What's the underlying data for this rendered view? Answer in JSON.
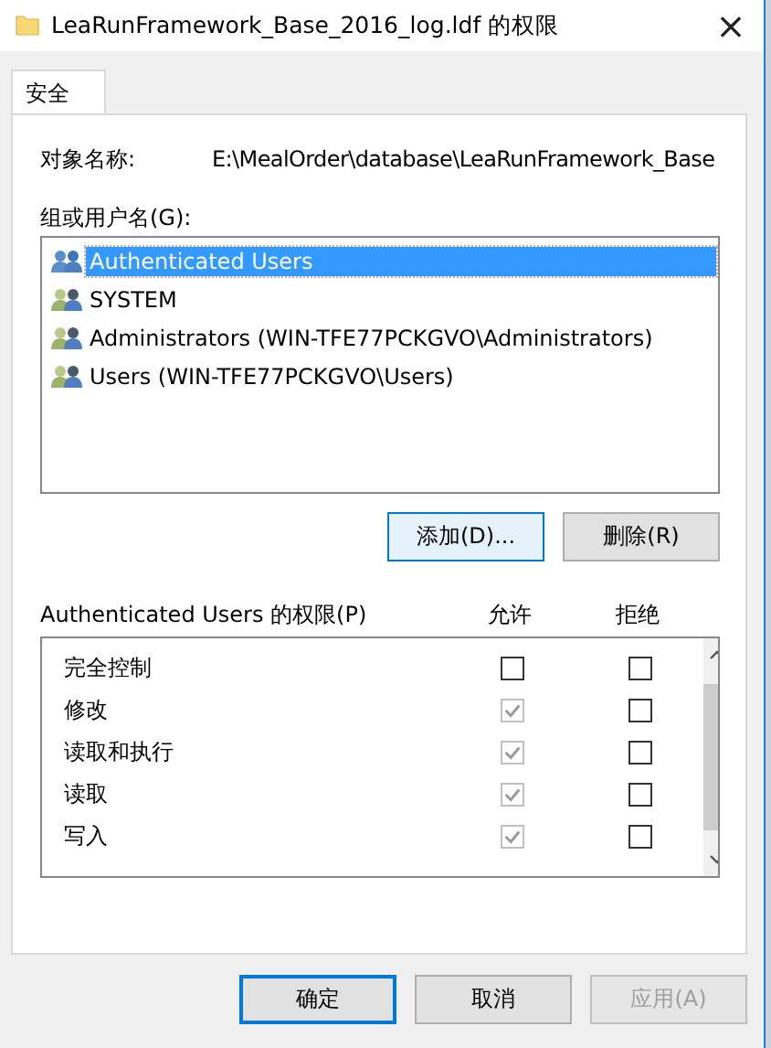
{
  "window": {
    "title": "LeaRunFramework_Base_2016_log.ldf 的权限",
    "close": "×"
  },
  "tabs": [
    {
      "label": "安全",
      "selected": true
    }
  ],
  "object_name": {
    "label": "对象名称:",
    "value": "E:\\MealOrder\\database\\LeaRunFramework_Base"
  },
  "groups": {
    "label": "组或用户名(G):",
    "items": [
      {
        "name": "Authenticated Users",
        "selected": true
      },
      {
        "name": "SYSTEM",
        "selected": false
      },
      {
        "name": "Administrators (WIN-TFE77PCKGVO\\Administrators)",
        "selected": false
      },
      {
        "name": "Users (WIN-TFE77PCKGVO\\Users)",
        "selected": false
      }
    ],
    "buttons": [
      {
        "label": "添加(D)...",
        "focused": true
      },
      {
        "label": "删除(R)",
        "focused": false
      }
    ]
  },
  "permissions": {
    "label": "Authenticated Users 的权限(P)",
    "columns": [
      "允许",
      "拒绝"
    ],
    "rows": [
      {
        "name": "完全控制",
        "allow": false,
        "allow_disabled": false,
        "deny": false
      },
      {
        "name": "修改",
        "allow": true,
        "allow_disabled": true,
        "deny": false
      },
      {
        "name": "读取和执行",
        "allow": true,
        "allow_disabled": true,
        "deny": false
      },
      {
        "name": "读取",
        "allow": true,
        "allow_disabled": true,
        "deny": false
      },
      {
        "name": "写入",
        "allow": true,
        "allow_disabled": true,
        "deny": false
      }
    ]
  },
  "buttons": [
    {
      "label": "确定",
      "default": true,
      "disabled": false
    },
    {
      "label": "取消",
      "default": false,
      "disabled": false
    },
    {
      "label": "应用(A)",
      "default": false,
      "disabled": true
    }
  ]
}
